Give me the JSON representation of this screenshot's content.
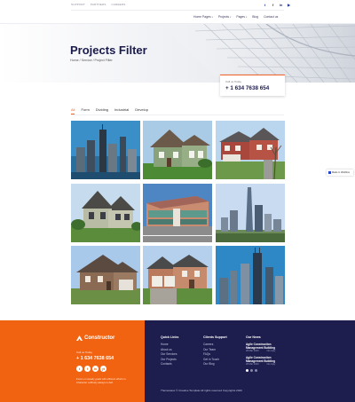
{
  "topbar": {
    "links": [
      "SUPPORT",
      "PARTNERS",
      "CAREERS"
    ],
    "socials": [
      "twitter-icon",
      "facebook-icon",
      "linkedin-icon",
      "youtube-icon"
    ]
  },
  "nav": {
    "items": [
      {
        "label": "Home Pages",
        "dropdown": true
      },
      {
        "label": "Projects",
        "dropdown": true
      },
      {
        "label": "Pages",
        "dropdown": true
      },
      {
        "label": "Blog",
        "dropdown": false
      },
      {
        "label": "Contact us",
        "dropdown": false
      }
    ]
  },
  "hero": {
    "title": "Projects Filter",
    "breadcrumb": "Home / Service / Project Filter",
    "contact_label": "Call us Today",
    "contact_number": "+ 1 634 7638 654"
  },
  "filters": {
    "tabs": [
      "All",
      "Form",
      "Dividing",
      "Industrial",
      "Develop"
    ],
    "active": "All"
  },
  "projects": [
    {
      "name": "city-skyline-project"
    },
    {
      "name": "green-house-project"
    },
    {
      "name": "red-brick-house-project"
    },
    {
      "name": "victorian-house-project"
    },
    {
      "name": "office-building-project"
    },
    {
      "name": "downtown-towers-project"
    },
    {
      "name": "stone-house-project"
    },
    {
      "name": "suburban-home-project"
    },
    {
      "name": "blue-skyscraper-project"
    }
  ],
  "badge": {
    "text": "Made in Webflow"
  },
  "footer": {
    "brand": "Constructor",
    "call_label": "Call us Today",
    "call_number": "+ 1 634 7638 654",
    "socials": [
      "t",
      "f",
      "in",
      "yt"
    ],
    "blurb": "Focus on steady goals with efficient efforts in. Character selfbody always is deft.",
    "quick_links": {
      "heading": "Quick Links",
      "items": [
        "Home",
        "About us",
        "Our Services",
        "Our Projects",
        "Contacts"
      ]
    },
    "clients_support": {
      "heading": "Clients Support",
      "items": [
        "Careers",
        "Our Team",
        "FAQs",
        "Get in Touch",
        "Our Blog"
      ]
    },
    "news": {
      "heading": "Our News",
      "items": [
        {
          "title_1": "Agile Construction",
          "title_2": "Management Building",
          "date": "28 Mar 2020",
          "comments": "No reply"
        },
        {
          "title_1": "Agile Construction",
          "title_2": "Management Building",
          "date": "28 Mar 2020",
          "comments": "No reply"
        }
      ]
    },
    "copyright": "Themewave © Creative Template All rights reserved Copyrights 2020"
  },
  "colors": {
    "accent": "#f26311",
    "navy": "#1d1e4e",
    "title": "#1b1b4b"
  }
}
